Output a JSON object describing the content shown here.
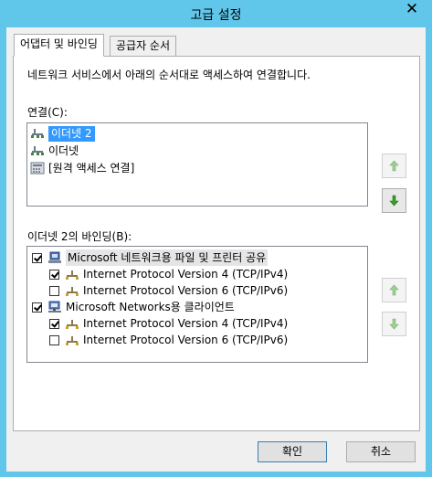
{
  "window": {
    "title": "고급 설정",
    "close_glyph": "✕"
  },
  "tabs": [
    {
      "label": "어댑터 및 바인딩",
      "active": true
    },
    {
      "label": "공급자 순서",
      "active": false
    }
  ],
  "panel": {
    "description": "네트워크 서비스에서 아래의 순서대로 액세스하여 연결합니다.",
    "connections_label": "연결(C):",
    "connections": [
      {
        "label": "이더넷 2",
        "icon": "network-adapter-icon",
        "selected": true
      },
      {
        "label": "이더넷",
        "icon": "network-adapter-icon",
        "selected": false
      },
      {
        "label": "[원격 액세스 연결]",
        "icon": "remote-access-icon",
        "selected": false
      }
    ],
    "bindings_label": "이더넷 2의 바인딩(B):",
    "bindings": [
      {
        "label": "Microsoft 네트워크용 파일 및 프린터 공유",
        "checked": true,
        "level": 0,
        "icon": "file-printer-sharing-icon",
        "highlighted": true
      },
      {
        "label": "Internet Protocol Version 4 (TCP/IPv4)",
        "checked": true,
        "level": 1,
        "icon": "protocol-icon",
        "highlighted": false
      },
      {
        "label": "Internet Protocol Version 6 (TCP/IPv6)",
        "checked": false,
        "level": 1,
        "icon": "protocol-icon",
        "highlighted": false
      },
      {
        "label": "Microsoft Networks용 클라이언트",
        "checked": true,
        "level": 0,
        "icon": "network-client-icon",
        "highlighted": false
      },
      {
        "label": "Internet Protocol Version 4 (TCP/IPv4)",
        "checked": true,
        "level": 1,
        "icon": "protocol-icon",
        "highlighted": false
      },
      {
        "label": "Internet Protocol Version 6 (TCP/IPv6)",
        "checked": false,
        "level": 1,
        "icon": "protocol-icon",
        "highlighted": false
      }
    ]
  },
  "buttons": {
    "ok": "확인",
    "cancel": "취소"
  },
  "colors": {
    "frame": "#61c7ea",
    "selection": "#3399ff",
    "arrow_green": "#3a9a2a"
  }
}
